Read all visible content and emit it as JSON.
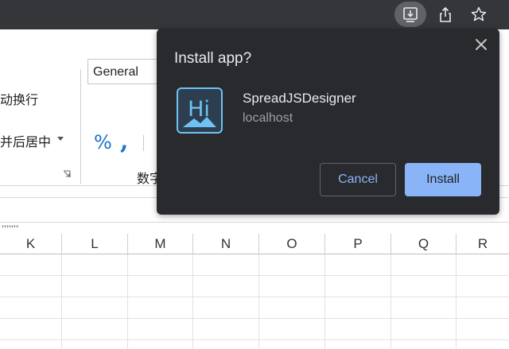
{
  "browser": {
    "icons": [
      "install-app-icon",
      "share-icon",
      "bookmark-star-icon"
    ]
  },
  "ribbon": {
    "wrap_text": "动换行",
    "merge_center": "并后居中",
    "number_format": "General",
    "percent_symbol": "%",
    "comma_symbol": ",",
    "number_group": "数字"
  },
  "sheet": {
    "columns": [
      "K",
      "L",
      "M",
      "N",
      "O",
      "P",
      "Q",
      "R"
    ]
  },
  "dialog": {
    "title": "Install app?",
    "app_name": "SpreadJSDesigner",
    "app_host": "localhost",
    "icon_text": "Hi",
    "cancel_label": "Cancel",
    "install_label": "Install"
  },
  "colors": {
    "dialog_bg": "#292a2d",
    "accent": "#8ab4f8",
    "toolbar_bg": "#35363a",
    "app_icon_bg": "#2d3e50",
    "app_icon_fg": "#6ec3f4"
  }
}
